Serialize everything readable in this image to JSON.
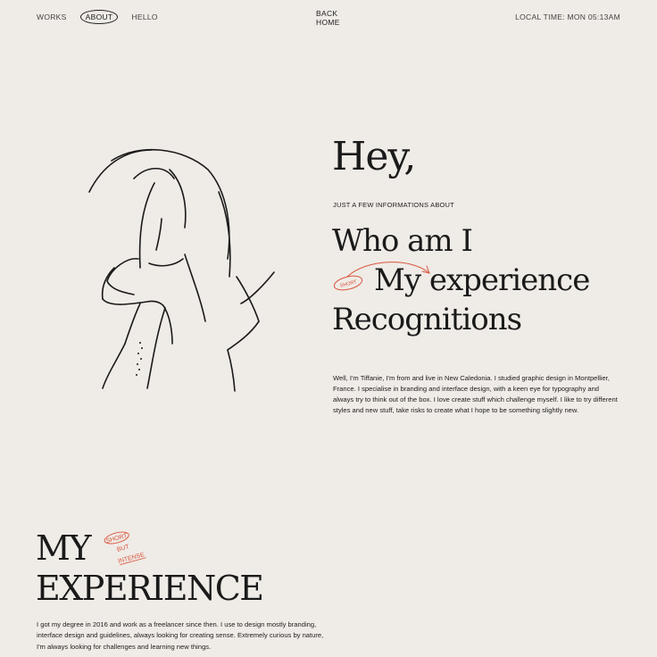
{
  "nav": {
    "items": [
      {
        "label": "WORKS",
        "active": false
      },
      {
        "label": "ABOUT",
        "active": true
      },
      {
        "label": "HELLO",
        "active": false
      }
    ],
    "home_line1": "BACK",
    "home_line2": "HOME",
    "local_time": "LOCAL TIME: MON 05:13AM"
  },
  "hero": {
    "greeting": "Hey,",
    "label": "JUST A FEW INFORMATIONS ABOUT",
    "menu": [
      "Who am I",
      "My experience",
      "Recognitions"
    ],
    "badge": "SHORT",
    "bio": "Well, I'm Tiffanie, I'm from and live in New Caledonia. I studied graphic design in Montpellier, France. I specialise in branding and interface design, with a keen eye for typography and always try to think out of the box. I love create stuff which challenge myself. I like to try different styles and new stuff, take risks to create what I hope to be something slightly new."
  },
  "experience": {
    "title_line1": "MY",
    "title_line2": "EXPERIENCE",
    "stamp": [
      "SHORT",
      "BUT",
      "INTENSE"
    ],
    "description": "I got my degree in 2016 and work as a freelancer since then. I use to design mostly branding, interface design and guidelines, always looking for creating sense. Extremely curious by nature, I'm always looking for challenges and learning new things."
  },
  "colors": {
    "background": "#efebe6",
    "ink": "#1a1a1a",
    "accent": "#d9553f"
  },
  "icons": [
    "line-art-portrait-illustration",
    "curved-arrow-icon"
  ]
}
